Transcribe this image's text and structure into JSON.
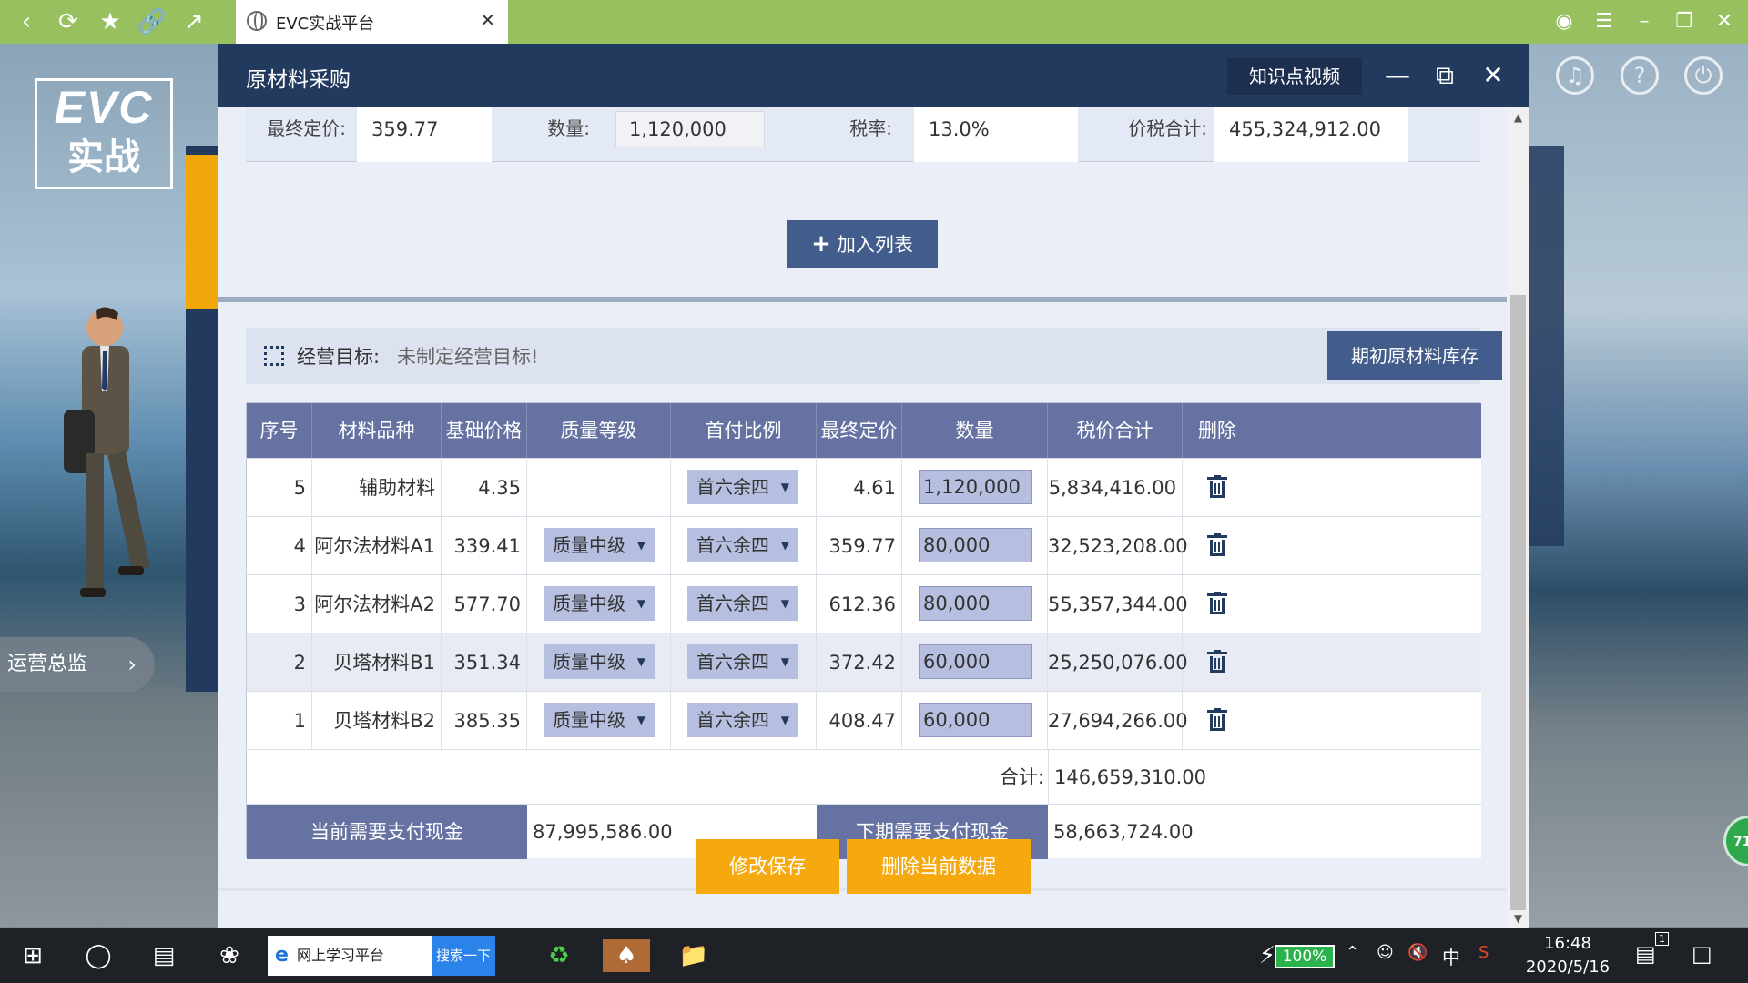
{
  "browser": {
    "tab_title": "EVC实战平台"
  },
  "background": {
    "logo_line1": "EVC",
    "logo_line2": "实战",
    "role_label": "运营总监",
    "badge_text": "71"
  },
  "modal": {
    "title": "原材料采购",
    "video_button": "知识点视频",
    "fields": {
      "final_price_label": "最终定价:",
      "final_price_value": "359.77",
      "quantity_label": "数量:",
      "quantity_value": "1,120,000",
      "tax_rate_label": "税率:",
      "tax_rate_value": "13.0%",
      "total_label": "价税合计:",
      "total_value": "455,324,912.00"
    },
    "add_button": "加入列表",
    "goal_label": "经营目标:",
    "goal_value": "未制定经营目标!",
    "inventory_button": "期初原材料库存",
    "table": {
      "headers": [
        "序号",
        "材料品种",
        "基础价格",
        "质量等级",
        "首付比例",
        "最终定价",
        "数量",
        "税价合计",
        "删除"
      ],
      "rows": [
        {
          "no": "5",
          "material": "辅助材料",
          "base_price": "4.35",
          "quality": "",
          "payment": "首六余四",
          "final_price": "4.61",
          "qty": "1,120,000",
          "total": "5,834,416.00"
        },
        {
          "no": "4",
          "material": "阿尔法材料A1",
          "base_price": "339.41",
          "quality": "质量中级",
          "payment": "首六余四",
          "final_price": "359.77",
          "qty": "80,000",
          "total": "32,523,208.00"
        },
        {
          "no": "3",
          "material": "阿尔法材料A2",
          "base_price": "577.70",
          "quality": "质量中级",
          "payment": "首六余四",
          "final_price": "612.36",
          "qty": "80,000",
          "total": "55,357,344.00"
        },
        {
          "no": "2",
          "material": "贝塔材料B1",
          "base_price": "351.34",
          "quality": "质量中级",
          "payment": "首六余四",
          "final_price": "372.42",
          "qty": "60,000",
          "total": "25,250,076.00"
        },
        {
          "no": "1",
          "material": "贝塔材料B2",
          "base_price": "385.35",
          "quality": "质量中级",
          "payment": "首六余四",
          "final_price": "408.47",
          "qty": "60,000",
          "total": "27,694,266.00"
        }
      ],
      "sum_label": "合计:",
      "sum_value": "146,659,310.00",
      "current_cash_label": "当前需要支付现金",
      "current_cash_value": "87,995,586.00",
      "next_cash_label": "下期需要支付现金",
      "next_cash_value": "58,663,724.00"
    },
    "save_button": "修改保存",
    "delete_button": "删除当前数据"
  },
  "taskbar": {
    "search_text": "网上学习平台",
    "search_button": "搜索一下",
    "battery": "100%",
    "ime": "中",
    "time": "16:48",
    "date": "2020/5/16",
    "notification_count": "1"
  },
  "colors": {
    "browser_bar": "#98c05f",
    "modal_header": "#223a5e",
    "table_header": "#6673a2",
    "orange_button": "#f5a90f",
    "blue_button": "#425d8c"
  }
}
